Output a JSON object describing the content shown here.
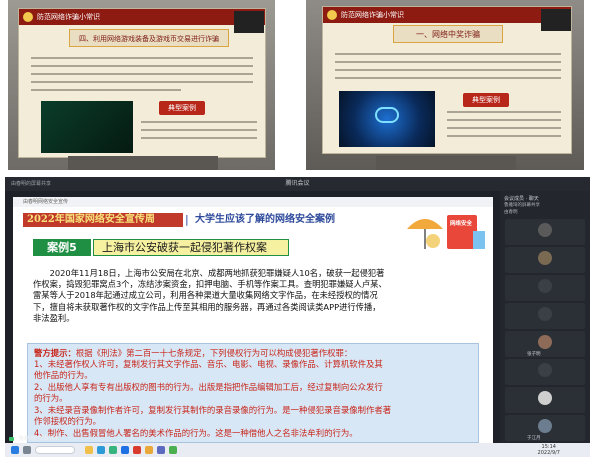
{
  "photos": {
    "left_poster": {
      "header": "防范网络诈骗小常识",
      "section": "四、利用网络游戏装备及游戏币交易进行诈骗",
      "badge": "典型案例"
    },
    "right_poster": {
      "header": "防范网络诈骗小常识",
      "section": "一、网络中奖诈骗",
      "badge": "典型案例"
    }
  },
  "meeting": {
    "window_title": "腾讯会议",
    "sharer_label": "由春明的屏幕共享",
    "share_bar": "鲁雅琦的屏幕共享",
    "slide": {
      "tab_label": "由春明网络安全宣传",
      "campaign": "2022年国家网络安全宣传周",
      "campaign_sub": "大学生应该了解的网络安全案例",
      "case_tag": "案例5",
      "case_title": "上海市公安破获一起侵犯著作权案",
      "illustration_sign": "网络安全",
      "body_lines": [
        "2020年11月18日，上海市公安局在北京、成都两地抓获犯罪嫌疑人10名，破获一起侵犯著",
        "作权案，捣毁犯罪窝点3个，冻结涉案资金，扣押电脑、手机等作案工具。查明犯罪嫌疑人卢某、",
        "雷某等人于2018年起通过成立公司，利用各种渠道大量收集网络文字作品，在未经授权的情况",
        "下，擅自将未获取著作权的文字作品上传至其相用的服务器，再通过各类阅读类APP进行传播，",
        "非法盈利。"
      ],
      "warning": {
        "head": "警方提示：",
        "lines": [
          "根据《刑法》第二百一十七条规定，下列侵权行为可以构成侵犯著作权罪：",
          "1、未经著作权人许可，复制发行其文字作品、音乐、电影、电视、录像作品、计算机软件及其",
          "他作品的行为。",
          "2、出版他人享有专有出版权的图书的行为。出版是指把作品编辑加工后，经过复制向公众发行",
          "的行为。",
          "3、未经录音录像制作者许可，复制发行其制作的录音录像的行为。是一种侵犯录音录像制作者著",
          "作邻接权的行为。",
          "4、制作、出售假冒他人署名的美术作品的行为。这是一种借他人之名非法牟利的行为。"
        ]
      }
    },
    "panel": {
      "header": "会议成员 · 聊天",
      "list": [
        "鲁雅琦的屏幕共享",
        "由春明"
      ],
      "tiles": [
        {
          "name": "",
          "color": "#5a5a5a"
        },
        {
          "name": "",
          "color": "#7a6a52"
        },
        {
          "name": "",
          "color": "#3b3f46"
        },
        {
          "name": "",
          "color": "#3b3f46"
        },
        {
          "name": "张子明",
          "color": "#8d6b58"
        },
        {
          "name": "",
          "color": "#3b3f46"
        },
        {
          "name": "",
          "color": "#cfcfcf"
        },
        {
          "name": "于江月",
          "color": "#6b7d8e"
        }
      ]
    },
    "taskbar": {
      "time": "15:14",
      "date": "2022/9/7"
    }
  }
}
